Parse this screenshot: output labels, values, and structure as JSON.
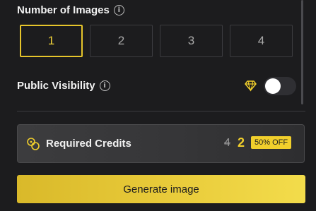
{
  "images": {
    "title": "Number of Images",
    "options": [
      "1",
      "2",
      "3",
      "4"
    ],
    "selected": "1"
  },
  "visibility": {
    "label": "Public Visibility",
    "enabled": false
  },
  "credits": {
    "label": "Required Credits",
    "original": "4",
    "current": "2",
    "discount": "50% OFF"
  },
  "actions": {
    "generate_label": "Generate image"
  },
  "colors": {
    "accent": "#f1cf2c",
    "background": "#1c1c1e"
  },
  "icons": {
    "info": "info-icon",
    "premium": "diamond-icon",
    "credits": "coins-icon"
  }
}
